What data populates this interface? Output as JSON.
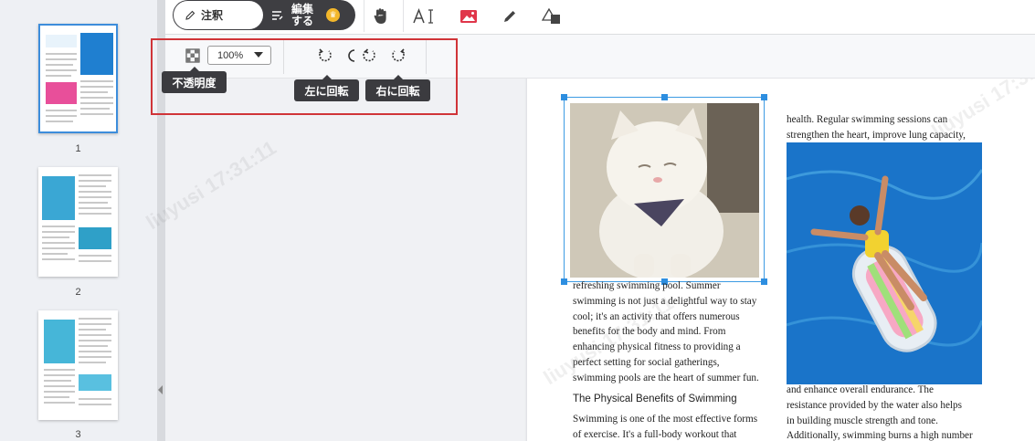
{
  "toolbar": {
    "annotate_label": "注釈",
    "edit_label": "編集する"
  },
  "subbar": {
    "opacity_tooltip": "不透明度",
    "zoom_value": "100%",
    "rotate_left_tooltip": "左に回転",
    "rotate_right_tooltip": "右に回転"
  },
  "thumbnails": [
    {
      "page": "1"
    },
    {
      "page": "2"
    },
    {
      "page": "3"
    }
  ],
  "document": {
    "left_column": [
      "refreshing swimming pool. Summer",
      "swimming is not just a delightful way to stay",
      "cool; it's an activity that offers numerous",
      "benefits for the body and mind. From",
      "enhancing physical fitness to providing a",
      "perfect setting for social gatherings,",
      "swimming pools are the heart of summer fun."
    ],
    "heading": "The Physical Benefits of Swimming",
    "left_column_2": [
      "Swimming is one of the most effective forms",
      "of exercise. It's a full-body workout that"
    ],
    "right_column_top": [
      "health. Regular swimming sessions can",
      "strengthen the heart, improve lung capacity,"
    ],
    "right_column_bottom": [
      "and enhance overall endurance. The",
      "resistance provided by the water also helps",
      "in building muscle strength and tone.",
      "Additionally, swimming burns a high number"
    ]
  },
  "watermark_text": "liuyusi 17:31:11",
  "colors": {
    "accent_blue": "#3d8ddb",
    "highlight_red": "#d03438",
    "dark": "#3e3e42",
    "image_tool_red": "#e0364a"
  }
}
